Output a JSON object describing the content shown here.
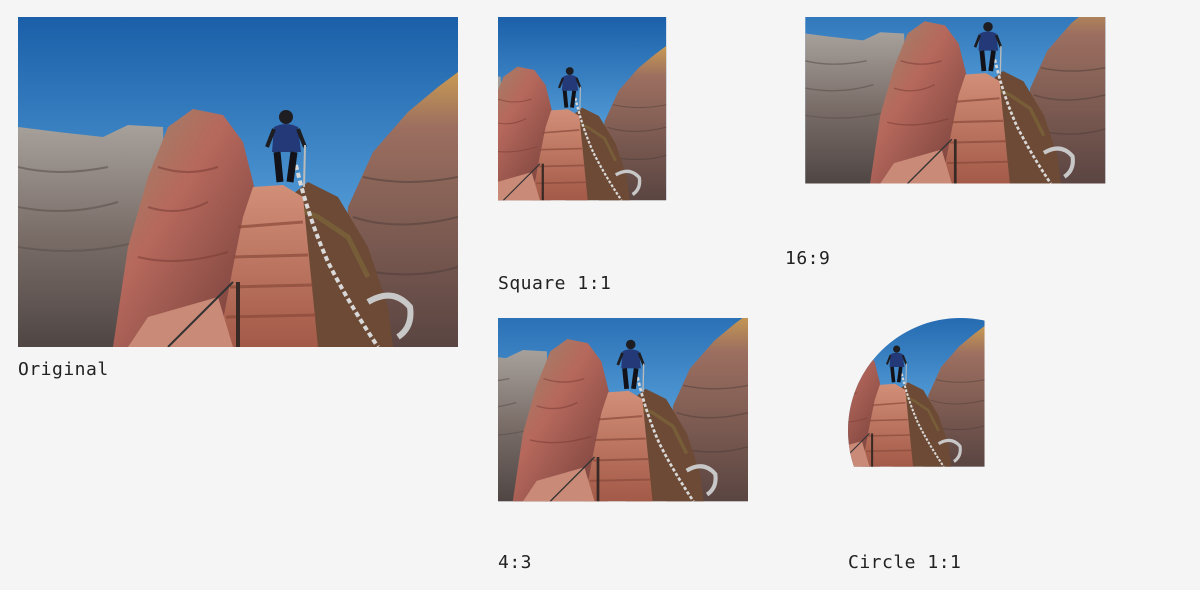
{
  "captions": {
    "original": "Original",
    "square": "Square 1:1",
    "ratio_16_9": "16:9",
    "ratio_4_3": "4:3",
    "circle": "Circle 1:1"
  },
  "colors": {
    "page_background": "#f5f5f5",
    "sky_top": "#1a5fa8",
    "sky_bottom": "#8fc4e6",
    "rock_red": "#b0605a",
    "rock_gray": "#6e6662"
  }
}
